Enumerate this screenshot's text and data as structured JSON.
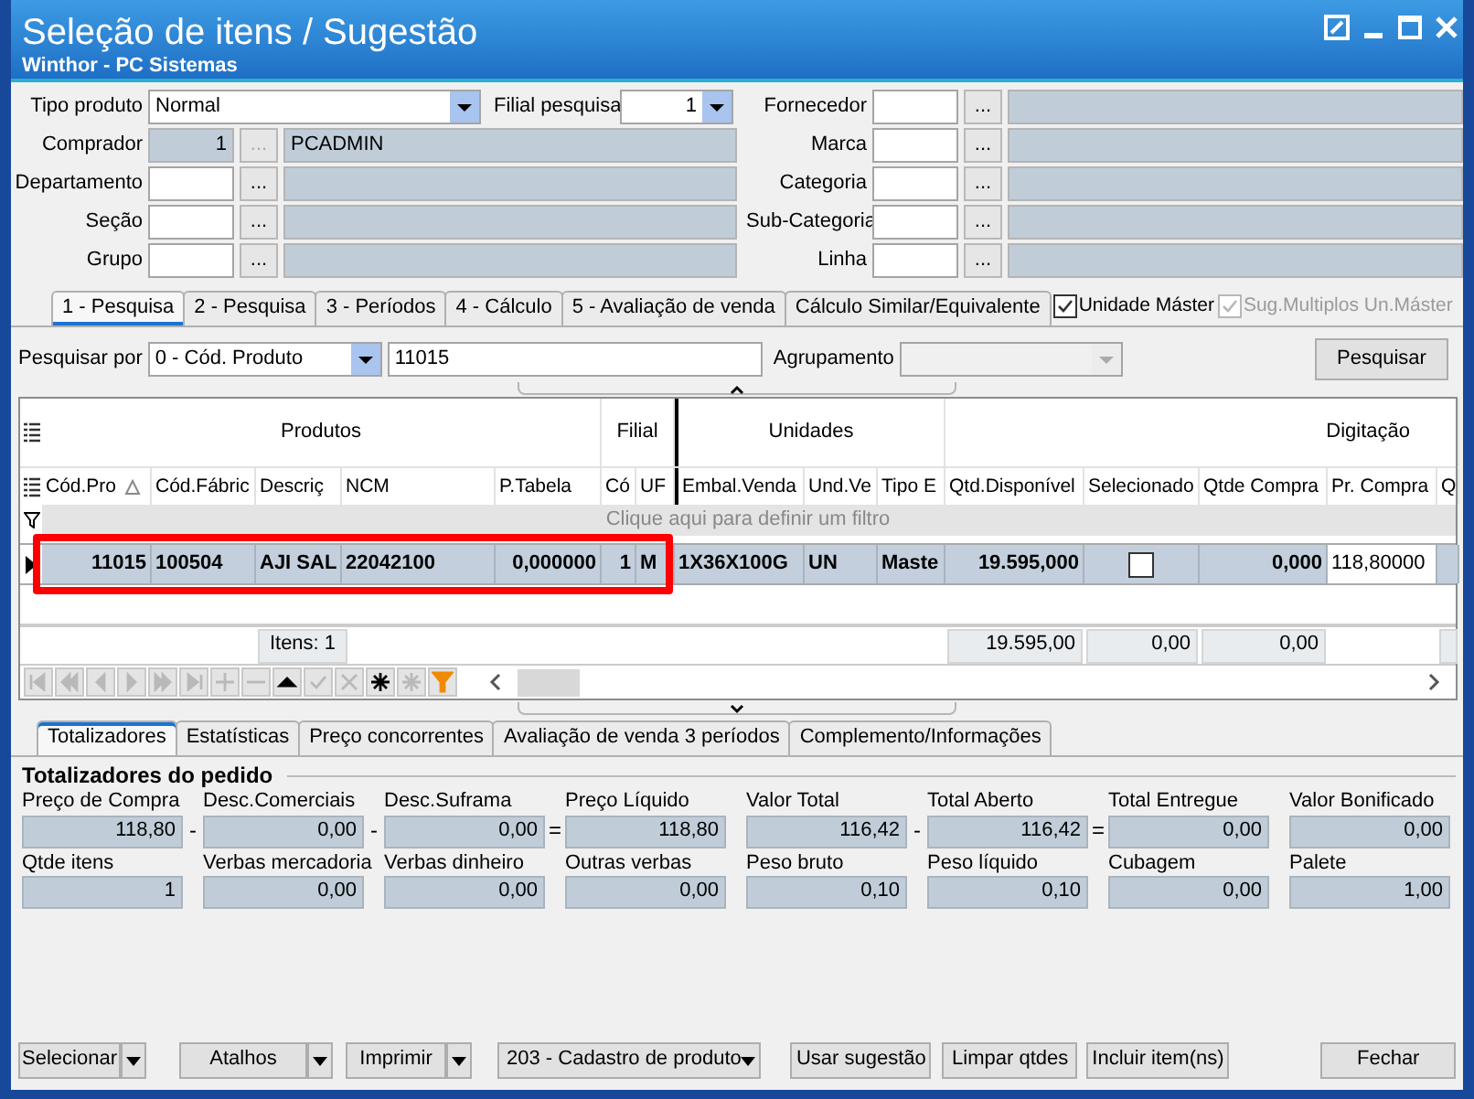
{
  "window": {
    "title": "Seleção de itens / Sugestão",
    "subtitle": "Winthor - PC Sistemas"
  },
  "filters": {
    "tipo_produto": {
      "label": "Tipo produto",
      "value": "Normal"
    },
    "filial_pesquisa": {
      "label": "Filial pesquisa",
      "value": "1"
    },
    "left": [
      {
        "label": "Comprador",
        "code": "1",
        "button": "...",
        "description": "PCADMIN",
        "disabled": true
      },
      {
        "label": "Departamento",
        "button": "...",
        "disabled": false
      },
      {
        "label": "Seção",
        "button": "...",
        "disabled": false
      },
      {
        "label": "Grupo",
        "button": "...",
        "disabled": false
      }
    ],
    "right": [
      {
        "label": "Fornecedor",
        "button": "...",
        "disabled": false
      },
      {
        "label": "Marca",
        "button": "...",
        "disabled": false
      },
      {
        "label": "Categoria",
        "button": "...",
        "disabled": false
      },
      {
        "label": "Sub-Categoria",
        "button": "...",
        "disabled": false
      },
      {
        "label": "Linha",
        "button": "...",
        "disabled": false
      }
    ]
  },
  "search_tabs": [
    {
      "label": "1 - Pesquisa",
      "selected": true
    },
    {
      "label": "2 - Pesquisa",
      "selected": false
    },
    {
      "label": "3 - Períodos",
      "selected": false
    },
    {
      "label": "4 - Cálculo",
      "selected": false
    },
    {
      "label": "5 - Avaliação de venda",
      "selected": false
    },
    {
      "label": "Cálculo Similar/Equivalente",
      "selected": false
    }
  ],
  "options": [
    {
      "label": "Unidade Máster",
      "checked": true,
      "disabled": false
    },
    {
      "label": "Sug.Multiplos Un.Máster",
      "checked": true,
      "disabled": true
    }
  ],
  "search": {
    "label": "Pesquisar por",
    "mode": "0 - Cód. Produto",
    "value": "11015",
    "grouping_label": "Agrupamento",
    "grouping_disabled": true,
    "button": "Pesquisar"
  },
  "grid": {
    "bands": [
      {
        "label": "Produtos",
        "columns": [
          {
            "label": "Cód.Pro",
            "sorted": true
          },
          {
            "label": "Cód.Fábric"
          },
          {
            "label": "Descriç",
            "total": "Itens: 1"
          },
          {
            "label": "NCM"
          },
          {
            "label": "P.Tabela"
          }
        ]
      },
      {
        "label": "Filial",
        "columns": [
          {
            "label": "Có"
          },
          {
            "label": "UF"
          }
        ]
      },
      {
        "label": "Unidades",
        "columns": [
          {
            "label": "Embal.Venda"
          },
          {
            "label": "Und.Ve"
          },
          {
            "label": "Tipo E"
          }
        ]
      },
      {
        "label": "Digitação",
        "columns": [
          {
            "label": "Qtd.Disponível",
            "total": "19.595,00"
          },
          {
            "label": "Selecionado",
            "total": "0,00"
          },
          {
            "label": "Qtde Compra",
            "total": "0,00"
          },
          {
            "label": "Pr. Compra"
          },
          {
            "label": "Q",
            "kind": "blank_total"
          }
        ]
      }
    ],
    "filter_hint": "Clique aqui para definir um filtro",
    "rows": [
      {
        "selected": true,
        "current": true,
        "cells": [
          {
            "text": "11015"
          },
          {
            "text": "100504"
          },
          {
            "text": "AJI SAL"
          },
          {
            "text": "22042100"
          },
          {
            "text": "0,000000"
          },
          {
            "text": "1"
          },
          {
            "text": "M"
          },
          {
            "text": "1X36X100G"
          },
          {
            "text": "UN"
          },
          {
            "text": "Maste"
          },
          {
            "text": "19.595,000"
          },
          {
            "kind": "checkbox",
            "checked": false
          },
          {
            "text": "0,000"
          },
          {
            "kind": "editor",
            "text": "118,80000"
          },
          {
            "kind": "empty"
          }
        ]
      }
    ]
  },
  "navigator": [
    {
      "kind": "first",
      "disabled": true
    },
    {
      "kind": "prior_page",
      "disabled": true
    },
    {
      "kind": "prior",
      "disabled": true
    },
    {
      "kind": "next",
      "disabled": true
    },
    {
      "kind": "next_page",
      "disabled": true
    },
    {
      "kind": "last",
      "disabled": true
    },
    {
      "kind": "insert",
      "disabled": true
    },
    {
      "kind": "delete",
      "disabled": true
    },
    {
      "kind": "up",
      "disabled": false
    },
    {
      "kind": "post",
      "disabled": true
    },
    {
      "kind": "cancel",
      "disabled": true
    },
    {
      "kind": "star",
      "disabled": false
    },
    {
      "kind": "stars",
      "disabled": true
    },
    {
      "kind": "filter",
      "disabled": false
    }
  ],
  "bottom_tabs": [
    {
      "label": "Totalizadores",
      "selected": true
    },
    {
      "label": "Estatísticas",
      "selected": false
    },
    {
      "label": "Preço concorrentes",
      "selected": false
    },
    {
      "label": "Avaliação de venda 3 períodos",
      "selected": false
    },
    {
      "label": "Complemento/Informações",
      "selected": false
    }
  ],
  "totals": {
    "title": "Totalizadores do pedido",
    "rows": [
      [
        {
          "label": "Preço de Compra",
          "value": "118,80",
          "operator": "-"
        },
        {
          "label": "Desc.Comerciais",
          "value": "0,00",
          "operator": "-"
        },
        {
          "label": "Desc.Suframa",
          "value": "0,00",
          "operator": "="
        },
        {
          "label": "Preço Líquido",
          "value": "118,80"
        },
        {
          "label": "Valor Total",
          "value": "116,42",
          "operator": "-"
        },
        {
          "label": "Total Aberto",
          "value": "116,42",
          "operator": "="
        },
        {
          "label": "Total Entregue",
          "value": "0,00"
        },
        {
          "label": "Valor Bonificado",
          "value": "0,00"
        }
      ],
      [
        {
          "label": "Qtde itens",
          "value": "1"
        },
        {
          "label": "Verbas mercadoria",
          "value": "0,00"
        },
        {
          "label": "Verbas dinheiro",
          "value": "0,00"
        },
        {
          "label": "Outras verbas",
          "value": "0,00"
        },
        {
          "label": "Peso bruto",
          "value": "0,10"
        },
        {
          "label": "Peso líquido",
          "value": "0,10"
        },
        {
          "label": "Cubagem",
          "value": "0,00"
        },
        {
          "label": "Palete",
          "value": "1,00"
        }
      ]
    ]
  },
  "buttons": [
    {
      "label": "Selecionar",
      "kind": "split"
    },
    {
      "label": "Atalhos",
      "kind": "split"
    },
    {
      "label": "Imprimir",
      "kind": "split"
    },
    {
      "label": "203 - Cadastro de produto",
      "kind": "combo"
    },
    {
      "label": "Usar sugestão",
      "kind": "plain"
    },
    {
      "label": "Limpar qtdes",
      "kind": "plain"
    },
    {
      "label": "Incluir item(ns)",
      "kind": "plain"
    },
    {
      "label": "Fechar",
      "kind": "plain"
    }
  ]
}
